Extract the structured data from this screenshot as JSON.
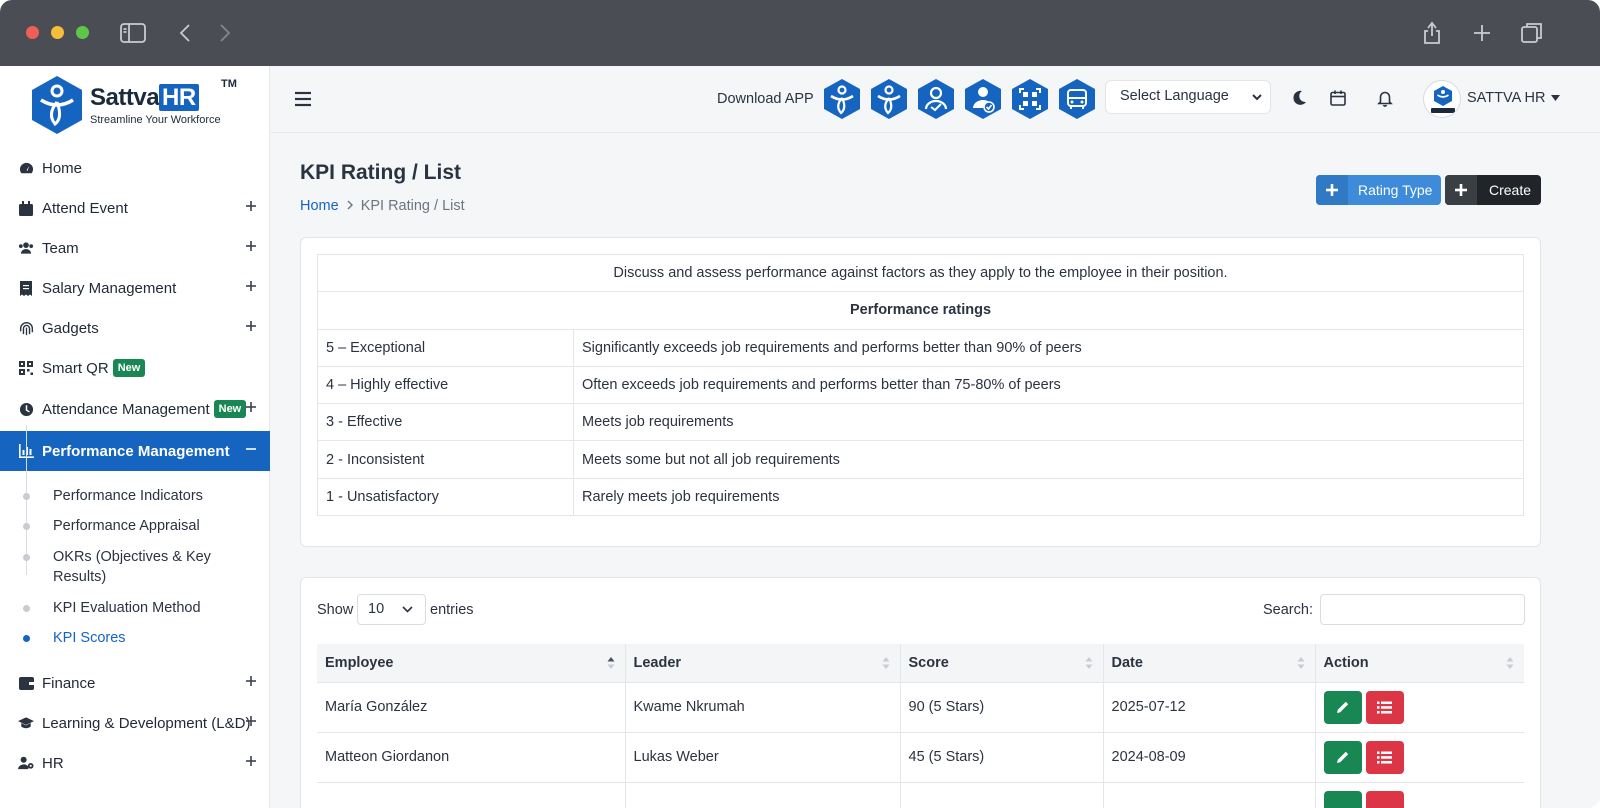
{
  "brand": {
    "name_prefix": "Sattva",
    "name_suffix": "HR",
    "trademark": "TM",
    "tagline": "Streamline Your Workforce",
    "color": "#1565c0"
  },
  "sidebar": {
    "items": [
      {
        "label": "Home",
        "icon": "dashboard-icon"
      },
      {
        "label": "Attend Event",
        "icon": "calendar-icon"
      },
      {
        "label": "Team",
        "icon": "users-icon"
      },
      {
        "label": "Salary Management",
        "icon": "receipt-icon"
      },
      {
        "label": "Gadgets",
        "icon": "fingerprint-icon"
      },
      {
        "label": "Smart QR",
        "icon": "qrcode-icon",
        "badge": "New"
      },
      {
        "label": "Attendance Management",
        "icon": "clock-icon",
        "badge": "New"
      },
      {
        "label": "Performance Management",
        "icon": "chart-bar-icon"
      },
      {
        "label": "Finance",
        "icon": "wallet-icon"
      },
      {
        "label": "Learning & Development (L&D)",
        "icon": "graduation-cap-icon"
      },
      {
        "label": "HR",
        "icon": "user-gear-icon"
      }
    ],
    "performance_sub": [
      "Performance Indicators",
      "Performance Appraisal",
      "OKRs (Objectives & Key Results)",
      "KPI Evaluation Method",
      "KPI Scores"
    ]
  },
  "header": {
    "download_label": "Download APP",
    "language_placeholder": "Select Language",
    "user_name": "SATTVA HR"
  },
  "page": {
    "title": "KPI Rating / List",
    "breadcrumb_home": "Home",
    "breadcrumb_current": "KPI Rating / List",
    "rating_type_button": "Rating Type",
    "create_button": "Create"
  },
  "ratings": {
    "intro": "Discuss and assess performance against factors as they apply to the employee in their position.",
    "heading": "Performance ratings",
    "rows": [
      {
        "level": "5 – Exceptional",
        "desc": "Significantly exceeds job requirements and performs better than 90% of peers"
      },
      {
        "level": "4 – Highly effective",
        "desc": "Often exceeds job requirements and performs better than 75-80% of peers"
      },
      {
        "level": "3 - Effective",
        "desc": "Meets job requirements"
      },
      {
        "level": "2 - Inconsistent",
        "desc": "Meets some but not all job requirements"
      },
      {
        "level": "1 - Unsatisfactory",
        "desc": "Rarely meets job requirements"
      }
    ]
  },
  "list": {
    "show_label": "Show",
    "page_size": "10",
    "entries_label": "entries",
    "search_label": "Search:",
    "columns": [
      "Employee",
      "Leader",
      "Score",
      "Date",
      "Action"
    ],
    "rows": [
      {
        "employee": "María González",
        "leader": "Kwame Nkrumah",
        "score": "90 (5 Stars)",
        "date": "2025-07-12"
      },
      {
        "employee": "Matteon Giordanon",
        "leader": "Lukas Weber",
        "score": "45 (5 Stars)",
        "date": "2024-08-09"
      }
    ]
  },
  "colors": {
    "primary": "#1565c0",
    "success": "#198754",
    "danger": "#dc3545",
    "dark": "#212529",
    "info_button": "#3d8bd9"
  }
}
